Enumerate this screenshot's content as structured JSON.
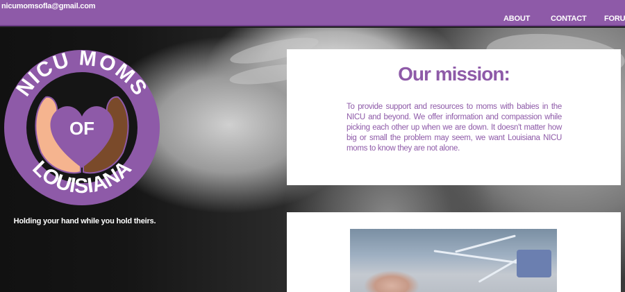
{
  "header": {
    "email": "nicumomsofla@gmail.com",
    "nav": [
      "ABOUT",
      "CONTACT",
      "FORUM"
    ]
  },
  "logo": {
    "top_text": "NICU MOMS",
    "middle_text": "OF",
    "bottom_text": "LOUISIANA"
  },
  "tagline": "Holding your hand while you hold theirs.",
  "mission": {
    "title": "Our mission:",
    "body": "To provide support and resources to moms with babies in the NICU and beyond. We offer information and compassion while picking each other up when we are down. It doesn't matter how big or small the problem may seem, we want Louisiana NICU moms to know they are not alone."
  },
  "colors": {
    "brand_purple": "#8e5aa8",
    "light_hand": "#f5b48f",
    "dark_hand": "#7a4a2a"
  }
}
